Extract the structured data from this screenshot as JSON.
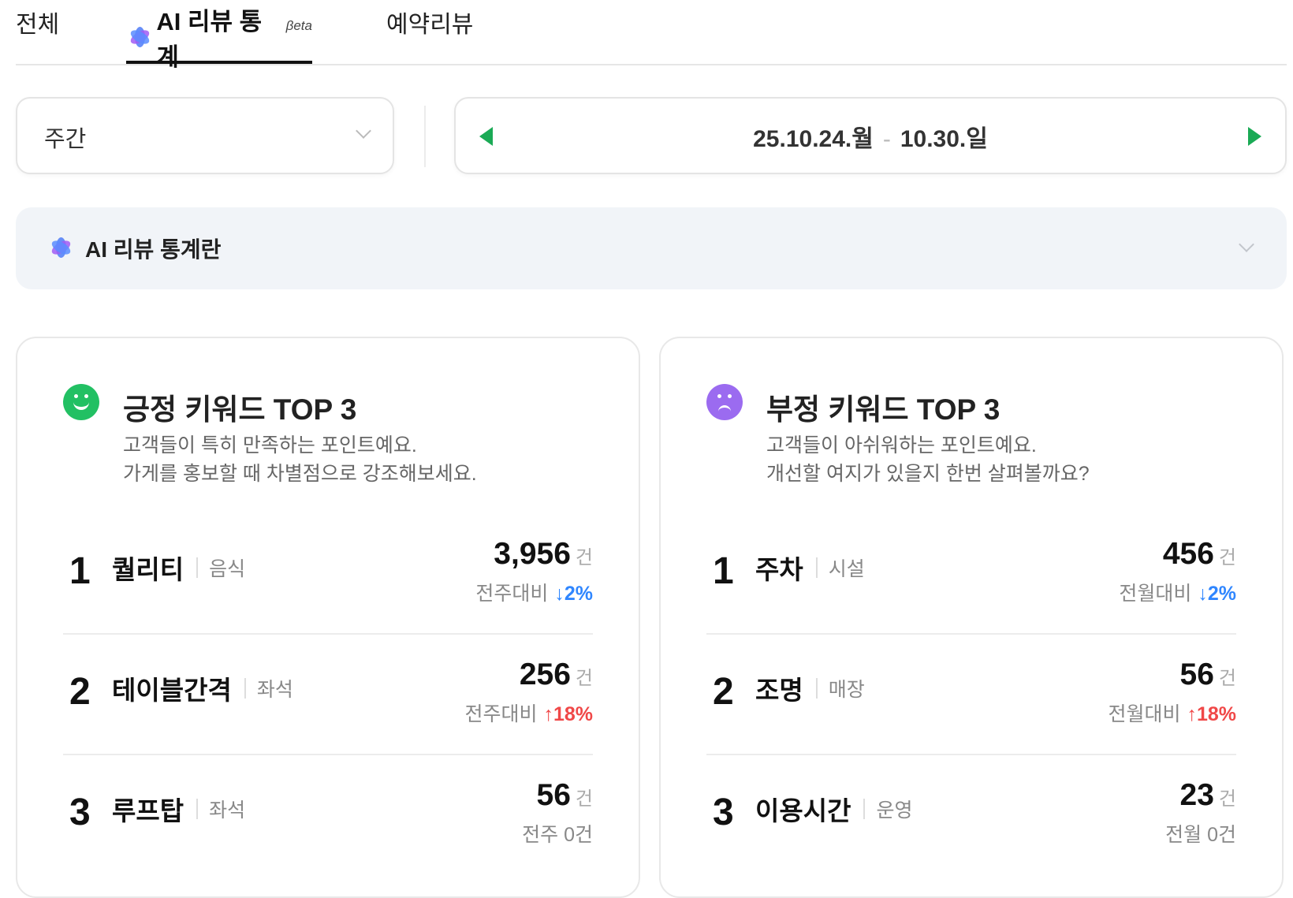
{
  "tabs": {
    "all": "전체",
    "ai_review": "AI 리뷰 통계",
    "beta": "βeta",
    "reservation": "예약리뷰"
  },
  "filter": {
    "period": "주간",
    "date_start": "25.10.24.월",
    "date_sep": "-",
    "date_end": "10.30.일"
  },
  "info_banner": {
    "title": "AI 리뷰 통계란"
  },
  "positive": {
    "title": "긍정 키워드 TOP 3",
    "desc_line1": "고객들이 특히 만족하는 포인트예요.",
    "desc_line2": "가게를 홍보할 때 차별점으로 강조해보세요.",
    "items": [
      {
        "rank": "1",
        "keyword": "퀄리티",
        "category": "음식",
        "count": "3,956",
        "unit": "건",
        "compare_label": "전주대비",
        "change": "↓2%",
        "direction": "down"
      },
      {
        "rank": "2",
        "keyword": "테이블간격",
        "category": "좌석",
        "count": "256",
        "unit": "건",
        "compare_label": "전주대비",
        "change": "↑18%",
        "direction": "up"
      },
      {
        "rank": "3",
        "keyword": "루프탑",
        "category": "좌석",
        "count": "56",
        "unit": "건",
        "compare_label": "전주 0건",
        "change": "",
        "direction": "none"
      }
    ]
  },
  "negative": {
    "title": "부정 키워드 TOP 3",
    "desc_line1": "고객들이 아쉬워하는 포인트예요.",
    "desc_line2": "개선할 여지가 있을지 한번 살펴볼까요?",
    "items": [
      {
        "rank": "1",
        "keyword": "주차",
        "category": "시설",
        "count": "456",
        "unit": "건",
        "compare_label": "전월대비",
        "change": "↓2%",
        "direction": "down"
      },
      {
        "rank": "2",
        "keyword": "조명",
        "category": "매장",
        "count": "56",
        "unit": "건",
        "compare_label": "전월대비",
        "change": "↑18%",
        "direction": "up"
      },
      {
        "rank": "3",
        "keyword": "이용시간",
        "category": "운영",
        "count": "23",
        "unit": "건",
        "compare_label": "전월 0건",
        "change": "",
        "direction": "none"
      }
    ]
  },
  "colors": {
    "accent_green": "#1aaa55",
    "positive_face": "#22c063",
    "negative_face": "#9b6bf0",
    "change_down": "#2f86ff",
    "change_up": "#f04848"
  },
  "icons": {
    "ai": "ai-sparkle-icon",
    "positive": "smile-face-icon",
    "negative": "frown-face-icon"
  }
}
